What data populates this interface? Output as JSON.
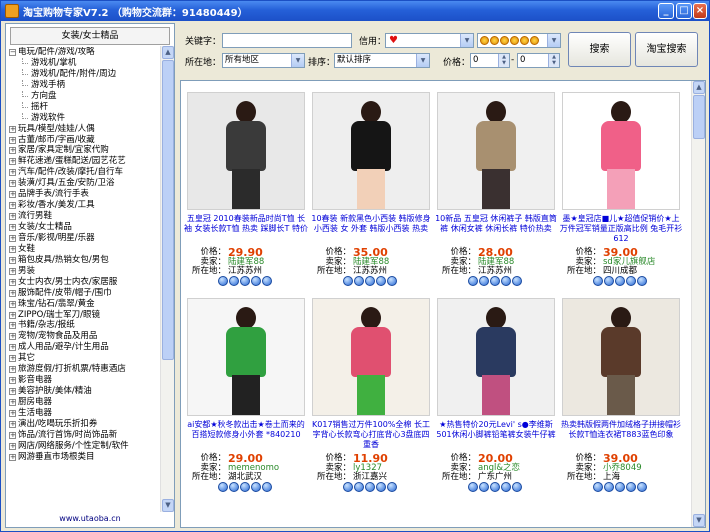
{
  "window": {
    "title": "淘宝购物专家V7.2 （购物交流群：91480449）",
    "min_label": "_",
    "max_label": "□",
    "close_label": "×"
  },
  "sidebar": {
    "header": "女装/女士精品",
    "footer": "www.utaoba.cn",
    "items": [
      {
        "label": "电玩/配件/游戏/攻略",
        "type": "expanded"
      },
      {
        "label": "游戏机/掌机",
        "type": "child"
      },
      {
        "label": "游戏机/配件/附件/周边",
        "type": "child"
      },
      {
        "label": "游戏手柄",
        "type": "child"
      },
      {
        "label": "方向盘",
        "type": "child"
      },
      {
        "label": "摇杆",
        "type": "child"
      },
      {
        "label": "游戏软件",
        "type": "child"
      },
      {
        "label": "玩具/模型/娃娃/人偶",
        "type": "collapsed"
      },
      {
        "label": "古董/邮币/字画/收藏",
        "type": "collapsed"
      },
      {
        "label": "家居/家具定制/宜家代购",
        "type": "collapsed"
      },
      {
        "label": "鲜花速递/蛋糕配送/园艺花艺",
        "type": "collapsed"
      },
      {
        "label": "汽车/配件/改装/摩托/自行车",
        "type": "collapsed"
      },
      {
        "label": "装潢/灯具/五金/安防/卫浴",
        "type": "collapsed"
      },
      {
        "label": "品牌手表/流行手表",
        "type": "collapsed"
      },
      {
        "label": "彩妆/香水/美发/工具",
        "type": "collapsed"
      },
      {
        "label": "流行男鞋",
        "type": "collapsed"
      },
      {
        "label": "女装/女士精品",
        "type": "collapsed"
      },
      {
        "label": "音乐/影视/明星/乐器",
        "type": "collapsed"
      },
      {
        "label": "女鞋",
        "type": "collapsed"
      },
      {
        "label": "箱包皮具/热销女包/男包",
        "type": "collapsed"
      },
      {
        "label": "男装",
        "type": "collapsed"
      },
      {
        "label": "女士内衣/男士内衣/家居服",
        "type": "collapsed"
      },
      {
        "label": "服饰配件/皮带/帽子/围巾",
        "type": "collapsed"
      },
      {
        "label": "珠宝/钻石/翡翠/黄金",
        "type": "collapsed"
      },
      {
        "label": "ZIPPO/瑞士军刀/眼镜",
        "type": "collapsed"
      },
      {
        "label": "书籍/杂志/报纸",
        "type": "collapsed"
      },
      {
        "label": "宠物/宠物食品及用品",
        "type": "collapsed"
      },
      {
        "label": "成人用品/避孕/计生用品",
        "type": "collapsed"
      },
      {
        "label": "其它",
        "type": "collapsed"
      },
      {
        "label": "旅游度假/打折机票/特惠酒店",
        "type": "collapsed"
      },
      {
        "label": "影音电器",
        "type": "collapsed"
      },
      {
        "label": "美容护肤/美体/精油",
        "type": "collapsed"
      },
      {
        "label": "厨房电器",
        "type": "collapsed"
      },
      {
        "label": "生活电器",
        "type": "collapsed"
      },
      {
        "label": "演出/吃喝玩乐折扣券",
        "type": "collapsed"
      },
      {
        "label": "饰品/流行首饰/时尚饰品新",
        "type": "collapsed"
      },
      {
        "label": "网店/网络服务/个性定制/软件",
        "type": "collapsed"
      },
      {
        "label": "网游垂直市场根类目",
        "type": "collapsed"
      }
    ]
  },
  "search": {
    "keyword_label": "关键字：",
    "keyword_value": "",
    "credit_label": "信用：",
    "location_label": "所在地：",
    "location_value": "所有地区",
    "sort_label": "排序：",
    "sort_value": "默认排序",
    "price_label": "价格：",
    "price_min": "0",
    "price_max": "0",
    "price_sep": "-",
    "search_button": "搜索",
    "taobao_search_button": "淘宝搜索"
  },
  "labels": {
    "price": "价格：",
    "seller": "卖家：",
    "location": "所在地："
  },
  "products": [
    {
      "title": "五皇冠 2010春装新品时尚T恤 长袖 女装长款T恤 热卖 踩脚长T 特价",
      "price": "29.90",
      "seller": "陆建军88",
      "location": "江苏苏州",
      "diamonds": 5
    },
    {
      "title": "10春装 新款黑色小西装 韩版修身小西装 女 外套 韩版小西装 热卖",
      "price": "35.00",
      "seller": "陆建军88",
      "location": "江苏苏州",
      "diamonds": 5
    },
    {
      "title": "10新品 五皇冠 休闲裤子 韩版直筒裤 休闲女裤 休闲长裤 特价热卖",
      "price": "28.00",
      "seller": "陆建军88",
      "location": "江苏苏州",
      "diamonds": 5
    },
    {
      "title": "墨★皇冠店■儿★超值促销价★上万件冠军销量正版高比例 兔毛开衫 612",
      "price": "39.00",
      "seller": "sd家儿旗舰店",
      "location": "四川成都",
      "diamonds": 5
    },
    {
      "title": "ai安都★秋冬款出击★卷土而来的百搭短款修身小外套 *840210",
      "price": "29.00",
      "seller": "memenomo",
      "location": "湖北武汉",
      "diamonds": 5
    },
    {
      "title": "K017销售过万件100%全棉 长工字背心长款弯心打底背心3盘底四重香",
      "price": "11.90",
      "seller": "ly1327",
      "location": "浙江嘉兴",
      "diamonds": 5
    },
    {
      "title": "★热售特价20元Levi' s●李维斯501休闲小脚裤铅笔裤女装牛仔裤",
      "price": "20.00",
      "seller": "angl&之恋",
      "location": "广东广州",
      "diamonds": 5
    },
    {
      "title": "热卖韩版假两件加绒格子拼接帽衫长款T恤连衣裙T883蓝色印象",
      "price": "39.00",
      "seller": "小乔8049",
      "location": "上海",
      "diamonds": 5
    }
  ],
  "colors": {
    "title_blue": "#0000d8",
    "price_orange": "#e04000",
    "seller_green": "#2a8a2a",
    "titlebar": "#2560d8"
  }
}
